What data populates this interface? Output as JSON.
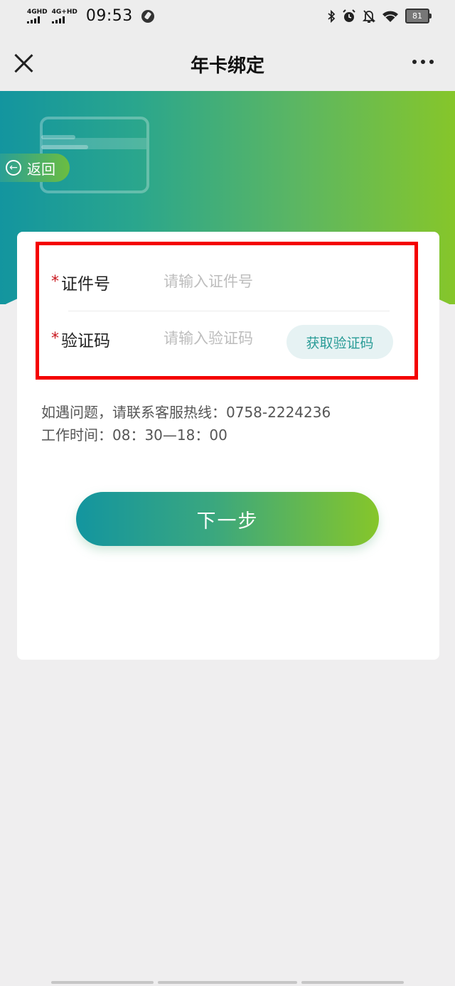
{
  "status_bar": {
    "net1": "4GHD",
    "net2": "4G+HD",
    "time": "09:53",
    "bluetooth_icon": "bluetooth-icon",
    "alarm_icon": "alarm-icon",
    "mute_icon": "bell-off-icon",
    "wifi_icon": "wifi-icon",
    "battery": "81"
  },
  "nav": {
    "title": "年卡绑定",
    "close_icon": "close-icon",
    "more_icon": "more-icon"
  },
  "banner": {
    "back_label": "返回",
    "gradient": [
      "#13959f",
      "#86c62a"
    ]
  },
  "form": {
    "id_label": "证件号",
    "id_placeholder": "请输入证件号",
    "code_label": "验证码",
    "code_placeholder": "请输入验证码",
    "required_mark": "*",
    "get_code_label": "获取验证码"
  },
  "notice": {
    "line1": "如遇问题，请联系客服热线：0758-2224236",
    "line2": "工作时间：08：30—18：00"
  },
  "next_label": "下一步",
  "colors": {
    "accent": "#2a9c97",
    "required": "#c8161d",
    "highlight": "#f40000"
  }
}
